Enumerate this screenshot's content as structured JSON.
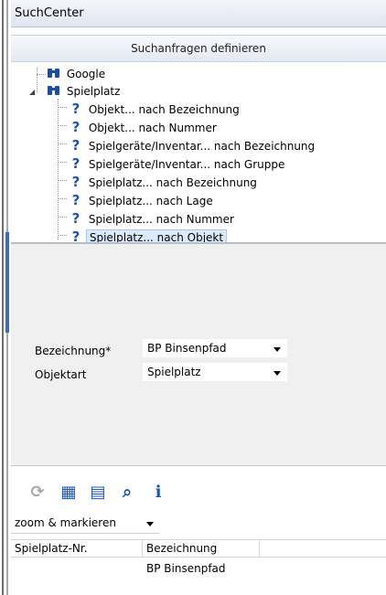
{
  "window": {
    "title": "SuchCenter"
  },
  "header": {
    "title": "Suchanfragen definieren"
  },
  "tree": {
    "root_nodes": [
      {
        "label": "Google",
        "icon": "binoculars-icon"
      },
      {
        "label": "Spielplatz",
        "icon": "binoculars-icon",
        "expanded": true
      }
    ],
    "queries": [
      {
        "label": "Objekt... nach Bezeichnung",
        "icon": "question-icon"
      },
      {
        "label": "Objekt... nach Nummer",
        "icon": "question-icon"
      },
      {
        "label": "Spielgeräte/Inventar... nach Bezeichnung",
        "icon": "question-icon"
      },
      {
        "label": "Spielgeräte/Inventar... nach Gruppe",
        "icon": "question-icon"
      },
      {
        "label": "Spielplatz... nach Bezeichnung",
        "icon": "question-icon"
      },
      {
        "label": "Spielplatz... nach Lage",
        "icon": "question-icon"
      },
      {
        "label": "Spielplatz... nach Nummer",
        "icon": "question-icon"
      },
      {
        "label": "Spielplatz... nach Objekt",
        "icon": "question-icon",
        "selected": true
      }
    ]
  },
  "form": {
    "fields": [
      {
        "label": "Bezeichnung*",
        "value": "BP Binsenpfad"
      },
      {
        "label": "Objektart",
        "value": "Spielplatz"
      }
    ]
  },
  "toolbar": {
    "icons": [
      "refresh-icon",
      "select-features-icon",
      "map-features-icon",
      "zoom-search-icon",
      "info-table-icon"
    ]
  },
  "results": {
    "mode": "zoom & markieren",
    "columns": [
      "Spielplatz-Nr.",
      "Bezeichnung"
    ],
    "rows": [
      [
        "",
        "BP Binsenpfad"
      ]
    ]
  },
  "colors": {
    "accent": "#1a56b5",
    "selection": "#dcebfc",
    "panel": "#f0f0f0"
  }
}
